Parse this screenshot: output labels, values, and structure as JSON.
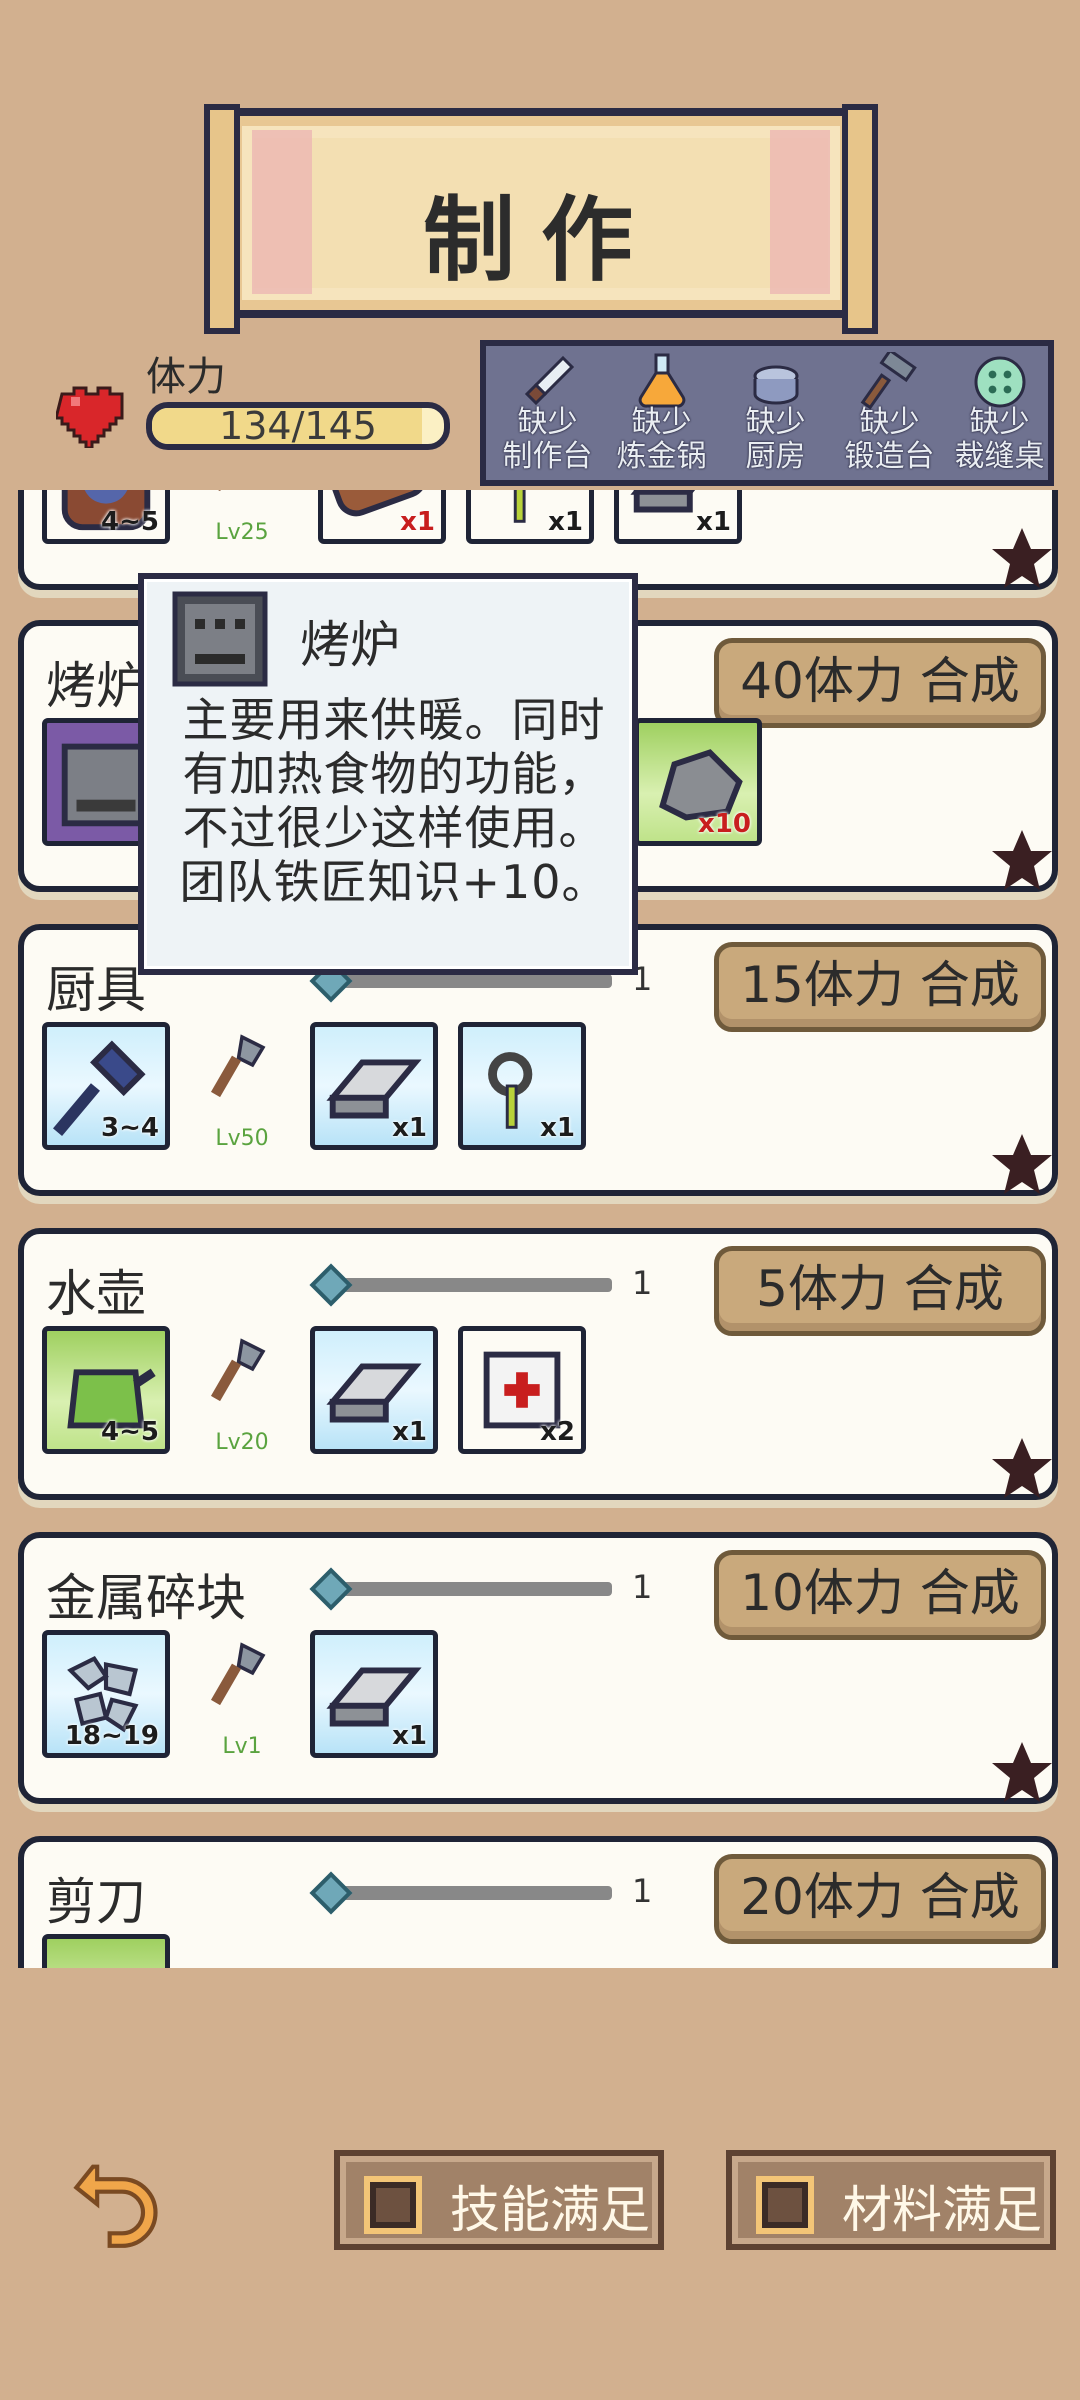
{
  "header": {
    "title": "制作"
  },
  "stamina": {
    "label": "体力",
    "value": "134/145",
    "fraction": 0.924
  },
  "stations": [
    {
      "icon": "knife-icon",
      "label": "缺少\n制作台"
    },
    {
      "icon": "flask-icon",
      "label": "缺少\n炼金锅"
    },
    {
      "icon": "pot-icon",
      "label": "缺少\n厨房"
    },
    {
      "icon": "hammer-icon",
      "label": "缺少\n锻造台"
    },
    {
      "icon": "button-icon",
      "label": "缺少\n裁缝桌"
    }
  ],
  "recipes": [
    {
      "name": "",
      "result_badge": "4~5",
      "tool_level": "Lv25",
      "materials": [
        {
          "icon": "wood-log-icon",
          "count": "x1"
        },
        {
          "icon": "iron-key-icon",
          "count": "x1"
        },
        {
          "icon": "iron-ingot-icon",
          "count": "x1"
        }
      ]
    },
    {
      "name": "烤炉",
      "craft_label": "40体力 合成",
      "materials_visible": [
        {
          "icon": "stone-icon",
          "count": "x10"
        }
      ],
      "result_badge": "1"
    },
    {
      "name": "厨具",
      "slider_value": "1",
      "craft_label": "15体力 合成",
      "result_badge": "3~4",
      "tool_level": "Lv50",
      "materials": [
        {
          "icon": "iron-ingot-icon",
          "count": "x1"
        },
        {
          "icon": "iron-key-icon",
          "count": "x1"
        }
      ]
    },
    {
      "name": "水壶",
      "slider_value": "1",
      "craft_label": "5体力 合成",
      "result_badge": "4~5",
      "tool_level": "Lv20",
      "materials": [
        {
          "icon": "iron-ingot-icon",
          "count": "x1"
        },
        {
          "icon": "medkit-icon",
          "count": "x2"
        }
      ]
    },
    {
      "name": "金属碎块",
      "slider_value": "1",
      "craft_label": "10体力 合成",
      "result_badge": "18~19",
      "tool_level": "Lv1",
      "materials": [
        {
          "icon": "iron-ingot-icon",
          "count": "x1"
        }
      ]
    },
    {
      "name": "剪刀",
      "slider_value": "1",
      "craft_label": "20体力 合成"
    }
  ],
  "tooltip": {
    "title": "烤炉",
    "description": "主要用来供暖。同时有加热食物的功能，不过很少这样使用。团队铁匠知识+10。"
  },
  "footer": {
    "skill_filter": "技能满足",
    "material_filter": "材料满足"
  },
  "colors": {
    "background": "#d2b08f",
    "card": "#fdfbf4",
    "craft_button": "#c9a97c",
    "station_panel": "#6f7290",
    "heart": "#d9262a",
    "level_text": "#5aa33f"
  }
}
